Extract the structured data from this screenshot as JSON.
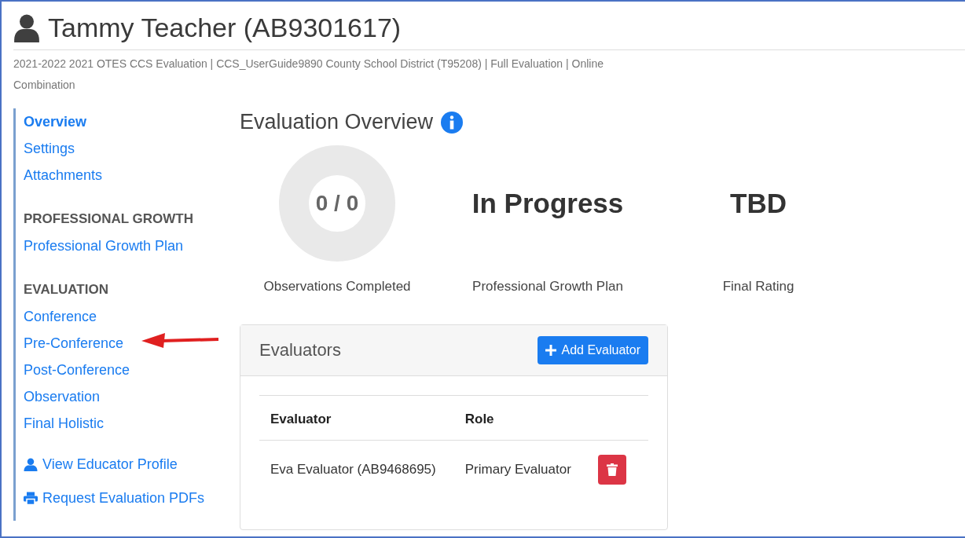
{
  "header": {
    "title": "Tammy Teacher (AB9301617)",
    "subtitle": "2021-2022 2021 OTES CCS Evaluation | CCS_UserGuide9890 County School District (T95208) | Full Evaluation | Online Combination"
  },
  "sidebar": {
    "groups": [
      {
        "items": [
          {
            "label": "Overview",
            "selected": true
          },
          {
            "label": "Settings",
            "selected": false
          },
          {
            "label": "Attachments",
            "selected": false
          }
        ]
      },
      {
        "heading": "PROFESSIONAL GROWTH",
        "items": [
          {
            "label": "Professional Growth Plan",
            "selected": false
          }
        ]
      },
      {
        "heading": "EVALUATION",
        "items": [
          {
            "label": "Conference",
            "selected": false
          },
          {
            "label": "Pre-Conference",
            "selected": false
          },
          {
            "label": "Post-Conference",
            "selected": false
          },
          {
            "label": "Observation",
            "selected": false
          },
          {
            "label": "Final Holistic",
            "selected": false
          }
        ]
      }
    ],
    "actions": [
      {
        "kind": "profile",
        "label": "View Educator Profile"
      },
      {
        "kind": "print",
        "label": "Request Evaluation PDFs"
      }
    ]
  },
  "overview": {
    "title": "Evaluation Overview",
    "stats": [
      {
        "kind": "donut",
        "value": "0 / 0",
        "label": "Observations Completed"
      },
      {
        "kind": "text",
        "value": "In Progress",
        "label": "Professional Growth Plan"
      },
      {
        "kind": "text",
        "value": "TBD",
        "label": "Final Rating"
      }
    ]
  },
  "evaluators": {
    "title": "Evaluators",
    "add_button": "Add Evaluator",
    "columns": [
      "Evaluator",
      "Role"
    ],
    "rows": [
      {
        "evaluator": "Eva Evaluator (AB9468695)",
        "role": "Primary Evaluator"
      }
    ]
  }
}
